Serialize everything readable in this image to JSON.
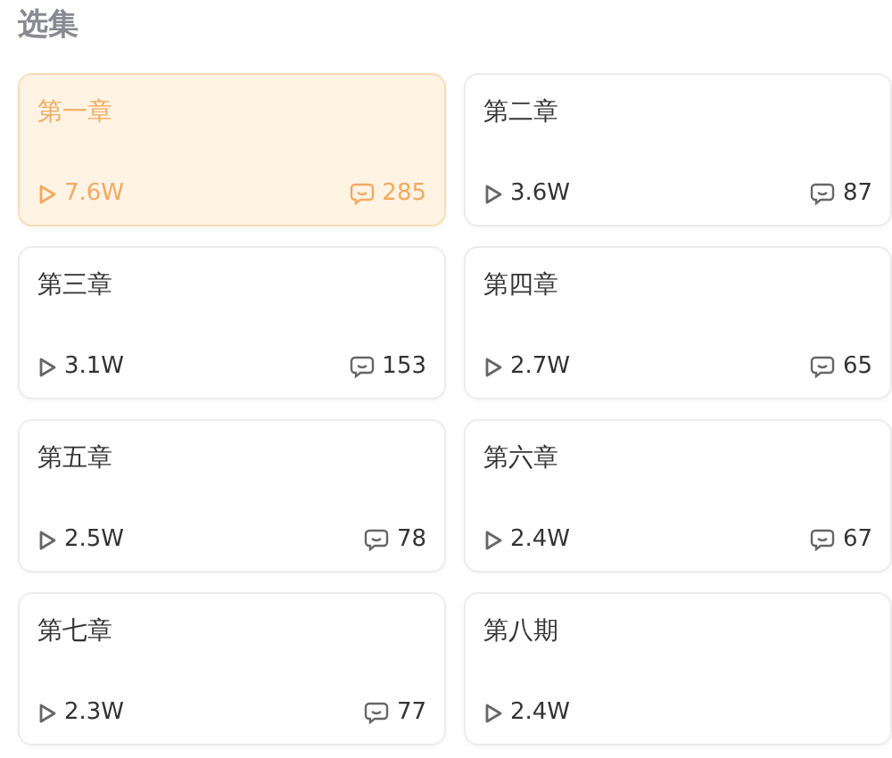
{
  "title": "选集",
  "episodes": [
    {
      "title": "第一章",
      "plays": "7.6W",
      "comments": "285",
      "selected": true
    },
    {
      "title": "第二章",
      "plays": "3.6W",
      "comments": "87",
      "selected": false
    },
    {
      "title": "第三章",
      "plays": "3.1W",
      "comments": "153",
      "selected": false
    },
    {
      "title": "第四章",
      "plays": "2.7W",
      "comments": "65",
      "selected": false
    },
    {
      "title": "第五章",
      "plays": "2.5W",
      "comments": "78",
      "selected": false
    },
    {
      "title": "第六章",
      "plays": "2.4W",
      "comments": "67",
      "selected": false
    },
    {
      "title": "第七章",
      "plays": "2.3W",
      "comments": "77",
      "selected": false
    },
    {
      "title": "第八期",
      "plays": "2.4W",
      "selected": false
    }
  ]
}
